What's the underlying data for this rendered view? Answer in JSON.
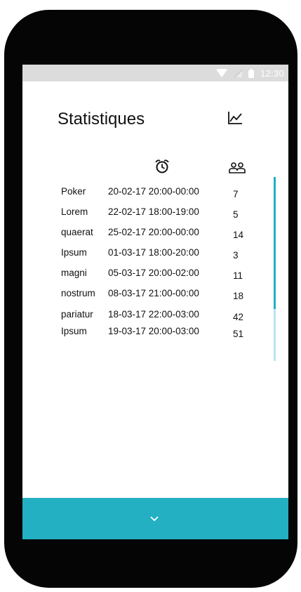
{
  "status_bar": {
    "time": "12:30",
    "icons": [
      "wifi-icon",
      "signal-icon",
      "battery-icon"
    ]
  },
  "header": {
    "title": "Statistiques",
    "chart_icon": "chart-icon"
  },
  "table": {
    "time_column_icon": "alarm-clock-icon",
    "count_column_icon": "people-icon",
    "rows": [
      {
        "name": "Poker",
        "time": "20-02-17 20:00-00:00",
        "count": "7"
      },
      {
        "name": "Lorem",
        "time": "22-02-17 18:00-19:00",
        "count": "5"
      },
      {
        "name": "quaerat",
        "time": "25-02-17 20:00-00:00",
        "count": "14"
      },
      {
        "name": "Ipsum",
        "time": "01-03-17 18:00-20:00",
        "count": "3"
      },
      {
        "name": "magni",
        "time": "05-03-17 20:00-02:00",
        "count": "11"
      },
      {
        "name": "nostrum",
        "time": "08-03-17 21:00-00:00",
        "count": "18"
      },
      {
        "name": "pariatur",
        "time": "18-03-17 22:00-03:00",
        "count": "42"
      },
      {
        "name": "Ipsum",
        "time": "19-03-17 20:00-03:00",
        "count": "51"
      }
    ]
  },
  "bottom_bar": {
    "icon": "chevron-down-icon"
  },
  "colors": {
    "accent": "#23b0c3",
    "scrollbar_thumb": "#22b1c2",
    "scrollbar_track": "#b9e4ea",
    "status_bar": "#dcdcdc",
    "phone_body": "#050505"
  }
}
